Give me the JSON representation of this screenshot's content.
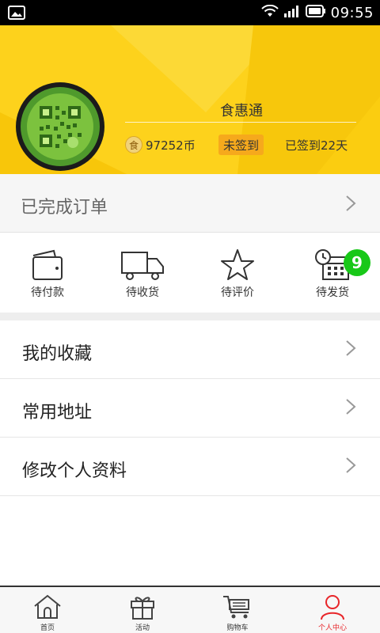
{
  "status_bar": {
    "time": "09:55",
    "icons": [
      "image-icon",
      "wifi-icon",
      "signal-icon",
      "battery-icon"
    ]
  },
  "profile": {
    "name": "食惠通",
    "coin_icon_text": "食",
    "coins": "97252币",
    "checkin_label": "未签到",
    "streak_label": "已签到22天"
  },
  "orders": {
    "completed_label": "已完成订单",
    "statuses": [
      {
        "label": "待付款",
        "icon": "wallet-icon"
      },
      {
        "label": "待收货",
        "icon": "truck-icon"
      },
      {
        "label": "待评价",
        "icon": "star-icon"
      },
      {
        "label": "待发货",
        "icon": "calendar-clock-icon"
      }
    ],
    "pending_ship_count": "9"
  },
  "menu": {
    "items": [
      {
        "label": "我的收藏"
      },
      {
        "label": "常用地址"
      },
      {
        "label": "修改个人资料"
      }
    ]
  },
  "tabbar": {
    "tabs": [
      {
        "label": "首页",
        "icon": "home-icon"
      },
      {
        "label": "活动",
        "icon": "gift-icon"
      },
      {
        "label": "购物车",
        "icon": "cart-icon"
      },
      {
        "label": "个人中心",
        "icon": "person-icon"
      }
    ],
    "active_index": 3
  },
  "colors": {
    "header_yellow": "#fbcd10",
    "checkin_orange": "#f6a91c",
    "badge_green": "#18c818",
    "active_tab_red": "#e8262a"
  }
}
